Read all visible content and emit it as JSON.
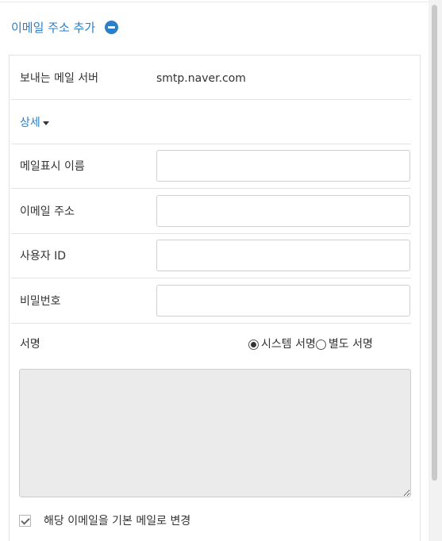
{
  "header": {
    "title": "이메일 주소 추가",
    "collapse_icon": "minus-circle-icon"
  },
  "server": {
    "label": "보내는 메일 서버",
    "value": "smtp.naver.com"
  },
  "detail": {
    "label": "상세",
    "icon": "caret-down-icon"
  },
  "fields": {
    "display_name": {
      "label": "메일표시 이름",
      "value": ""
    },
    "email": {
      "label": "이메일 주소",
      "value": ""
    },
    "user_id": {
      "label": "사용자 ID",
      "value": ""
    },
    "password": {
      "label": "비밀번호",
      "value": ""
    }
  },
  "signature": {
    "label": "서명",
    "options": [
      "시스템 서명",
      "별도 서명"
    ],
    "selected": "시스템 서명"
  },
  "default_checkbox": {
    "label": "해당 이메일을 기본 메일로 변경",
    "checked": true
  },
  "colors": {
    "accent": "#2b7fc7",
    "signature_bg": "#ebebeb"
  }
}
